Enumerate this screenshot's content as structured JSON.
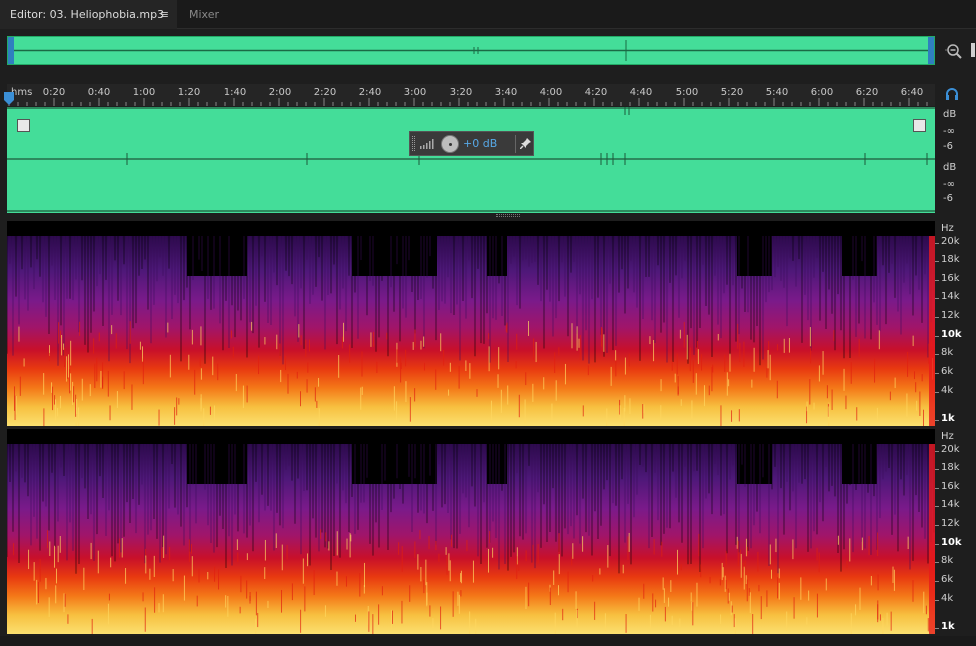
{
  "tabs": {
    "editor_label": "Editor: 03. Heliophobia.mp3",
    "editor_menu": "≡",
    "mixer_label": "Mixer"
  },
  "colors": {
    "waveform": "#44dd99",
    "accent": "#57a8e6"
  },
  "ruler": {
    "unit": "hms",
    "ticks": [
      "0:20",
      "0:40",
      "1:00",
      "1:20",
      "1:40",
      "2:00",
      "2:20",
      "2:40",
      "3:00",
      "3:20",
      "3:40",
      "4:00",
      "4:20",
      "4:40",
      "5:00",
      "5:20",
      "5:40",
      "6:00",
      "6:20",
      "6:40"
    ]
  },
  "hud": {
    "volume_value": "+0 dB"
  },
  "db_scale": {
    "channel1": [
      "dB",
      "-∞",
      "-6"
    ],
    "channel2": [
      "dB",
      "-∞",
      "-6"
    ]
  },
  "hz_scale": {
    "unit": "Hz",
    "labels": [
      "20k",
      "18k",
      "16k",
      "14k",
      "12k",
      "10k",
      "8k",
      "6k",
      "4k",
      "1k"
    ],
    "bold": [
      "10k",
      "1k"
    ]
  },
  "icons": {
    "zoom": "zoom-out-magnifier-icon",
    "monitor": "headphones-icon",
    "pin": "pin-icon",
    "volume": "volume-bars-icon"
  }
}
